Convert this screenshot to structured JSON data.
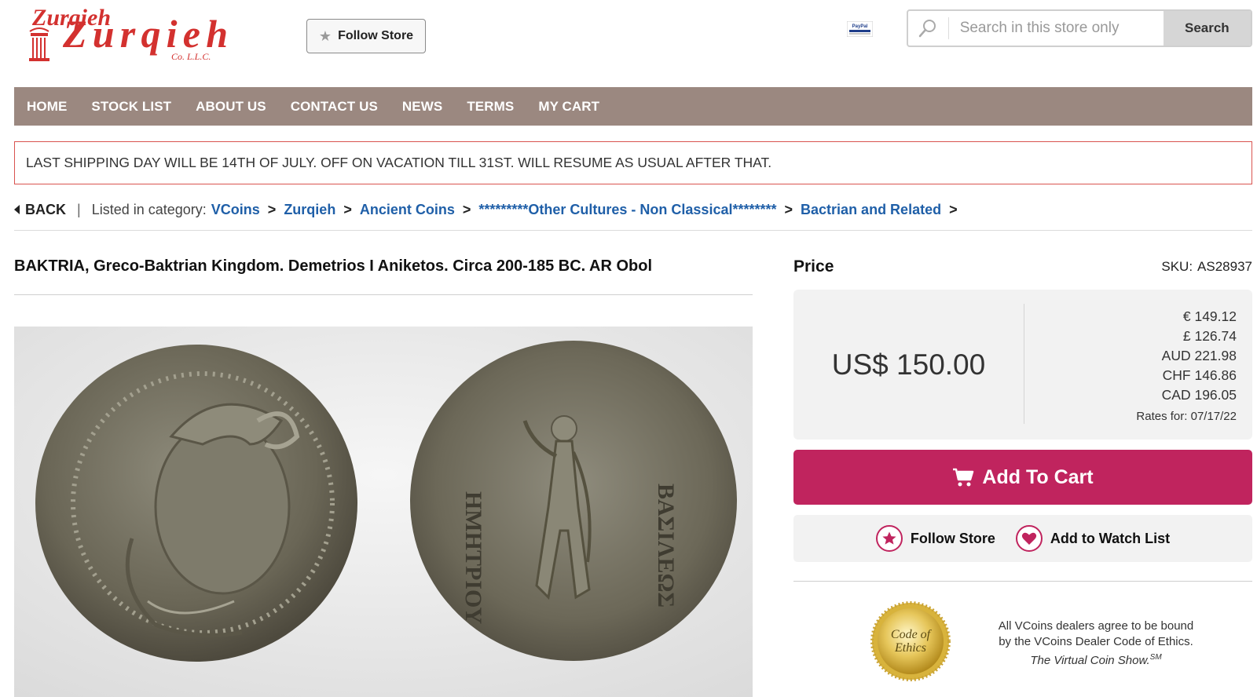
{
  "header": {
    "logo_text": "Zurqieh",
    "logo_sub": "Co. L.L.C.",
    "follow_store_label": "Follow Store",
    "search_placeholder": "Search in this store only",
    "search_button": "Search",
    "paypal_text": "PayPal"
  },
  "nav": {
    "items": [
      "HOME",
      "STOCK LIST",
      "ABOUT US",
      "CONTACT US",
      "NEWS",
      "TERMS",
      "MY CART"
    ]
  },
  "notice": "LAST SHIPPING DAY WILL BE 14TH OF JULY. OFF ON VACATION TILL 31ST. WILL RESUME AS USUAL AFTER THAT.",
  "breadcrumb": {
    "back": "BACK",
    "prefix": "Listed in category:",
    "crumbs": [
      "VCoins",
      "Zurqieh",
      "Ancient Coins",
      "*********Other Cultures - Non Classical********",
      "Bactrian and Related"
    ],
    "separator": ">"
  },
  "product": {
    "title": "BAKTRIA, Greco-Baktrian Kingdom. Demetrios I Aniketos. Circa 200-185 BC. AR Obol",
    "price_label": "Price",
    "sku_label": "SKU:",
    "sku": "AS28937",
    "price_main": "US$ 150.00",
    "conversions": [
      "€ 149.12",
      "£ 126.74",
      "AUD 221.98",
      "CHF 146.86",
      "CAD 196.05"
    ],
    "rates_for": "Rates for: 07/17/22",
    "add_to_cart": "Add To Cart",
    "follow_store": "Follow Store",
    "add_watch": "Add to Watch List"
  },
  "ethics": {
    "seal_line1": "Code of",
    "seal_line2": "Ethics",
    "line1": "All VCoins dealers agree to be bound",
    "line2": "by the VCoins Dealer Code of Ethics.",
    "show": "The Virtual Coin Show.",
    "sup": "SM"
  },
  "colors": {
    "nav_bg": "#9b8880",
    "notice_border": "#d9534f",
    "link": "#1f5fa8",
    "cart": "#c0245e",
    "logo_red": "#d3312f"
  }
}
